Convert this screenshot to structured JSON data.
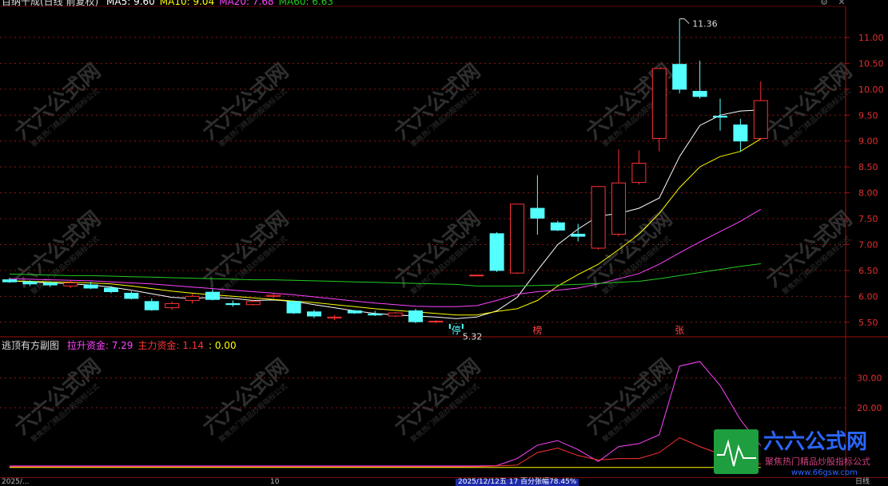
{
  "window_controls": {
    "gear": "⚙",
    "close": "✕"
  },
  "main_chart": {
    "title": "百纳千成(日线 前复权)",
    "ma_values": [
      {
        "label": "MA5:",
        "value": "9.60",
        "color": "#ffffff"
      },
      {
        "label": "MA10:",
        "value": "9.04",
        "color": "#ffff00"
      },
      {
        "label": "MA20:",
        "value": "7.68",
        "color": "#ff44ff"
      },
      {
        "label": "MA60:",
        "value": "6.63",
        "color": "#22cc22"
      }
    ],
    "high_label": "11.36",
    "low_label": "5.32",
    "markers": [
      "停",
      "榜",
      "张"
    ]
  },
  "sub_chart": {
    "title": "逃顶有方副图",
    "indicators": [
      {
        "label": "拉升资金:",
        "value": "7.29",
        "color": "#ff44ff"
      },
      {
        "label": "主力资金:",
        "value": "1.14",
        "color": "#ff3333"
      },
      {
        "label": ":",
        "value": "0.00",
        "color": "#ffff00"
      }
    ]
  },
  "watermark": {
    "brand": "六六公式网",
    "tagline": "聚焦热门精品炒股指标公式",
    "url": "www.66gsw.com"
  },
  "bottom_bar": {
    "left_text": "2025/...",
    "mid_text": "10",
    "date_info": "2025/12/12五 17 百分张幅78.45%",
    "right_text": "日线"
  },
  "chart_data": [
    {
      "type": "candlestick",
      "title": "",
      "x": [
        1,
        2,
        3,
        4,
        5,
        6,
        7,
        8,
        9,
        10,
        11,
        12,
        13,
        14,
        15,
        16,
        17,
        18,
        19,
        20,
        21,
        22,
        23,
        24,
        25,
        26,
        27,
        28,
        29,
        30,
        31,
        32,
        33,
        34,
        35,
        36,
        37,
        38
      ],
      "ohlc": [
        [
          6.32,
          6.36,
          6.26,
          6.28
        ],
        [
          6.28,
          6.31,
          6.2,
          6.24
        ],
        [
          6.26,
          6.29,
          6.18,
          6.22
        ],
        [
          6.2,
          6.3,
          6.16,
          6.26
        ],
        [
          6.22,
          6.28,
          6.14,
          6.16
        ],
        [
          6.16,
          6.2,
          6.06,
          6.09
        ],
        [
          6.06,
          6.1,
          5.94,
          5.96
        ],
        [
          5.9,
          5.96,
          5.72,
          5.74
        ],
        [
          5.78,
          5.9,
          5.74,
          5.86
        ],
        [
          5.92,
          6.05,
          5.86,
          6.0
        ],
        [
          6.08,
          6.14,
          5.92,
          5.94
        ],
        [
          5.86,
          5.92,
          5.8,
          5.84
        ],
        [
          5.84,
          5.94,
          5.82,
          5.9
        ],
        [
          6.0,
          6.06,
          5.96,
          6.02
        ],
        [
          5.9,
          5.92,
          5.66,
          5.68
        ],
        [
          5.7,
          5.74,
          5.58,
          5.62
        ],
        [
          5.58,
          5.64,
          5.54,
          5.6
        ],
        [
          5.72,
          5.74,
          5.66,
          5.68
        ],
        [
          5.66,
          5.72,
          5.62,
          5.64
        ],
        [
          5.62,
          5.7,
          5.6,
          5.68
        ],
        [
          5.72,
          5.76,
          5.48,
          5.51
        ],
        [
          5.52,
          5.54,
          5.48,
          5.52
        ],
        [
          5.46,
          5.48,
          5.32,
          5.38
        ],
        [
          6.41,
          6.41,
          6.41,
          6.41
        ],
        [
          7.21,
          7.24,
          6.47,
          6.5
        ],
        [
          6.45,
          6.54,
          6.43,
          7.78
        ],
        [
          7.7,
          8.34,
          7.19,
          7.51
        ],
        [
          7.42,
          7.46,
          7.26,
          7.28
        ],
        [
          7.2,
          7.4,
          7.06,
          7.16
        ],
        [
          6.93,
          8.13,
          6.9,
          8.12
        ],
        [
          7.2,
          8.84,
          7.16,
          8.19
        ],
        [
          8.2,
          8.82,
          8.16,
          8.57
        ],
        [
          9.05,
          10.41,
          8.8,
          10.4
        ],
        [
          10.48,
          11.36,
          9.92,
          10.0
        ],
        [
          9.96,
          10.55,
          9.82,
          9.86
        ],
        [
          9.48,
          9.82,
          9.2,
          9.46
        ],
        [
          9.31,
          9.43,
          8.8,
          9.0
        ],
        [
          9.05,
          10.15,
          9.03,
          9.78
        ]
      ],
      "series": [
        {
          "name": "MA5",
          "values": [
            6.3,
            6.28,
            6.26,
            6.24,
            6.22,
            6.18,
            6.12,
            6.05,
            5.98,
            5.96,
            5.98,
            5.96,
            5.92,
            5.93,
            5.9,
            5.84,
            5.78,
            5.72,
            5.67,
            5.64,
            5.62,
            5.6,
            5.57,
            5.6,
            5.72,
            5.98,
            6.5,
            7.0,
            7.3,
            7.55,
            7.6,
            7.7,
            7.9,
            8.7,
            9.3,
            9.5,
            9.58,
            9.6
          ]
        },
        {
          "name": "MA10",
          "values": [
            6.3,
            6.29,
            6.28,
            6.27,
            6.26,
            6.24,
            6.2,
            6.15,
            6.1,
            6.06,
            6.03,
            6.0,
            5.97,
            5.94,
            5.91,
            5.88,
            5.84,
            5.8,
            5.76,
            5.73,
            5.7,
            5.67,
            5.64,
            5.64,
            5.71,
            5.76,
            5.92,
            6.2,
            6.42,
            6.62,
            6.9,
            7.2,
            7.6,
            8.1,
            8.5,
            8.7,
            8.8,
            9.04
          ]
        },
        {
          "name": "MA20",
          "values": [
            6.34,
            6.33,
            6.32,
            6.31,
            6.3,
            6.28,
            6.26,
            6.24,
            6.21,
            6.18,
            6.15,
            6.12,
            6.09,
            6.06,
            6.03,
            5.99,
            5.95,
            5.91,
            5.87,
            5.84,
            5.81,
            5.8,
            5.8,
            5.82,
            5.92,
            6.04,
            6.09,
            6.12,
            6.16,
            6.24,
            6.34,
            6.44,
            6.62,
            6.84,
            7.05,
            7.25,
            7.45,
            7.68
          ]
        },
        {
          "name": "MA60",
          "values": [
            6.43,
            6.42,
            6.41,
            6.4,
            6.4,
            6.39,
            6.38,
            6.37,
            6.36,
            6.35,
            6.34,
            6.33,
            6.32,
            6.32,
            6.31,
            6.3,
            6.29,
            6.28,
            6.27,
            6.26,
            6.25,
            6.24,
            6.23,
            6.2,
            6.2,
            6.2,
            6.21,
            6.22,
            6.23,
            6.25,
            6.27,
            6.29,
            6.34,
            6.4,
            6.46,
            6.52,
            6.58,
            6.63
          ]
        }
      ],
      "yticks": [
        5.5,
        6.0,
        6.5,
        7.0,
        7.5,
        8.0,
        8.5,
        9.0,
        9.5,
        10.0,
        10.5,
        11.0
      ],
      "ylim": [
        5.25,
        11.6
      ],
      "grid": true,
      "legend": "top-left"
    },
    {
      "type": "line",
      "title": "",
      "x": [
        1,
        2,
        3,
        4,
        5,
        6,
        7,
        8,
        9,
        10,
        11,
        12,
        13,
        14,
        15,
        16,
        17,
        18,
        19,
        20,
        21,
        22,
        23,
        24,
        25,
        26,
        27,
        28,
        29,
        30,
        31,
        32,
        33,
        34,
        35,
        36,
        37,
        38
      ],
      "series": [
        {
          "name": "拉升资金",
          "values": [
            0.5,
            0.5,
            0.5,
            0.5,
            0.5,
            0.5,
            0.5,
            0.5,
            0.5,
            0.5,
            0.5,
            0.5,
            0.5,
            0.5,
            0.5,
            0.5,
            0.5,
            0.5,
            0.5,
            0.5,
            0.5,
            0.5,
            0.5,
            0.5,
            0.6,
            3.0,
            7.5,
            9.0,
            6.0,
            2.0,
            7.0,
            8.0,
            11.0,
            34.0,
            35.5,
            27.5,
            16.0,
            7.29
          ]
        },
        {
          "name": "主力资金",
          "values": [
            0.2,
            0.2,
            0.2,
            0.2,
            0.2,
            0.2,
            0.2,
            0.2,
            0.2,
            0.2,
            0.2,
            0.2,
            0.2,
            0.2,
            0.2,
            0.2,
            0.2,
            0.2,
            0.2,
            0.2,
            0.2,
            0.2,
            0.2,
            0.3,
            0.5,
            0.8,
            5.0,
            6.5,
            4.0,
            2.5,
            3.0,
            3.0,
            5.0,
            10.0,
            7.0,
            4.5,
            2.0,
            1.14
          ]
        },
        {
          "name": "",
          "values": [
            0,
            0,
            0,
            0,
            0,
            0,
            0,
            0,
            0,
            0,
            0,
            0,
            0,
            0,
            0,
            0,
            0,
            0,
            0,
            0,
            0,
            0,
            0,
            0,
            0,
            0,
            0,
            0,
            0,
            0,
            0,
            0,
            0,
            0,
            0,
            0,
            0,
            0
          ]
        }
      ],
      "yticks": [
        20.0,
        30.0
      ],
      "ylim": [
        -3,
        39
      ],
      "grid": true,
      "legend": "top-left"
    }
  ]
}
